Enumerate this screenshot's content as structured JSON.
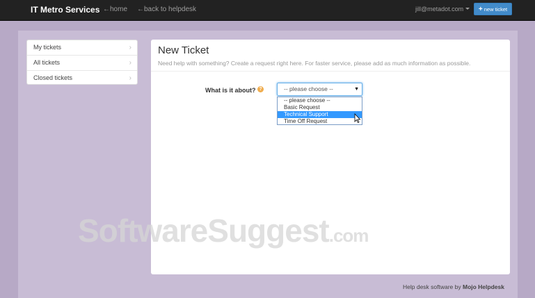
{
  "nav": {
    "brand": "IT Metro Services",
    "home_link": "←home",
    "back_link": "←back to helpdesk",
    "user_email": "jill@metadot.com",
    "new_ticket_label": "new ticket"
  },
  "sidebar": {
    "items": [
      {
        "label": "My tickets"
      },
      {
        "label": "All tickets"
      },
      {
        "label": "Closed tickets"
      }
    ]
  },
  "main": {
    "title": "New Ticket",
    "subtitle": "Need help with something? Create a request right here. For faster service, please add as much information as possible.",
    "question_label": "What is it about?",
    "select_value": "-- please choose --",
    "options": [
      {
        "label": "-- please choose --",
        "selected": false
      },
      {
        "label": "Basic Request",
        "selected": false
      },
      {
        "label": "Technical Support",
        "selected": true
      },
      {
        "label": "Time Off Request",
        "selected": false
      }
    ]
  },
  "watermark": {
    "main": "SoftwareSuggest",
    "suffix": ".com"
  },
  "footer": {
    "text": "Help desk software by ",
    "brand": "Mojo Helpdesk"
  },
  "colors": {
    "accent": "#428bca",
    "highlight": "#3399ff",
    "navbar": "#222222",
    "background": "#b7a9c6"
  }
}
